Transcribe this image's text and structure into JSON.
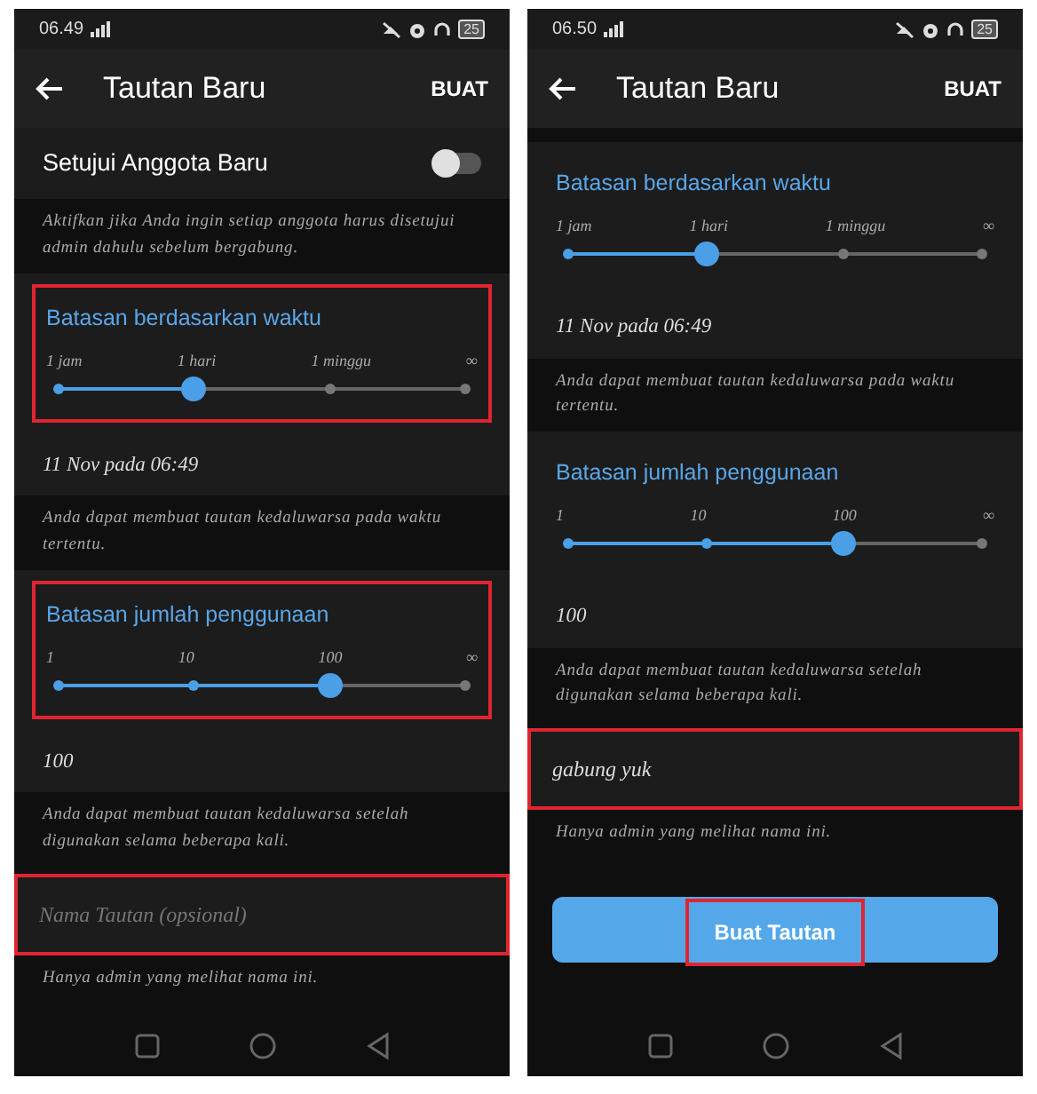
{
  "screens": [
    {
      "status_bar": {
        "time": "06.49",
        "battery": "25"
      },
      "app_bar": {
        "title": "Tautan Baru",
        "action": "BUAT"
      },
      "sections": [
        {
          "kind": "toggle",
          "label": "Setujui Anggota Baru",
          "on": false
        },
        {
          "kind": "note",
          "text": "Aktifkan jika Anda ingin setiap anggota harus disetujui admin dahulu sebelum bergabung."
        },
        {
          "kind": "slider",
          "title": "Batasan berdasarkan waktu",
          "ticks": [
            "1 jam",
            "1 hari",
            "1 minggu",
            "∞"
          ],
          "level": 0.333,
          "value": "11 Nov pada 06:49",
          "highlighted": true
        },
        {
          "kind": "note",
          "text": "Anda dapat membuat tautan kedaluwarsa pada waktu tertentu."
        },
        {
          "kind": "slider",
          "title": "Batasan jumlah penggunaan",
          "ticks": [
            "1",
            "10",
            "100",
            "∞"
          ],
          "level": 0.667,
          "value": "100",
          "highlighted": true
        },
        {
          "kind": "note",
          "text": "Anda dapat membuat tautan kedaluwarsa setelah digunakan selama beberapa kali."
        },
        {
          "kind": "field",
          "placeholder": "Nama Tautan (opsional)",
          "highlighted": true
        },
        {
          "kind": "note",
          "text": "Hanya admin yang melihat nama ini."
        }
      ]
    },
    {
      "status_bar": {
        "time": "06.50",
        "battery": "25"
      },
      "app_bar": {
        "title": "Tautan Baru",
        "action": "BUAT"
      },
      "sections": [
        {
          "kind": "slider",
          "title": "Batasan berdasarkan waktu",
          "ticks": [
            "1 jam",
            "1 hari",
            "1 minggu",
            "∞"
          ],
          "level": 0.333,
          "value": "11 Nov pada 06:49",
          "highlighted": false
        },
        {
          "kind": "note",
          "text": "Anda dapat membuat tautan kedaluwarsa pada waktu tertentu."
        },
        {
          "kind": "slider",
          "title": "Batasan jumlah penggunaan",
          "ticks": [
            "1",
            "10",
            "100",
            "∞"
          ],
          "level": 0.667,
          "value": "100",
          "highlighted": false
        },
        {
          "kind": "note",
          "text": "Anda dapat membuat tautan kedaluwarsa setelah digunakan selama beberapa kali."
        },
        {
          "kind": "field",
          "value": "gabung yuk",
          "highlighted": true
        },
        {
          "kind": "note",
          "text": "Hanya admin yang melihat nama ini."
        },
        {
          "kind": "button",
          "label": "Buat Tautan",
          "highlighted": true
        }
      ]
    }
  ]
}
